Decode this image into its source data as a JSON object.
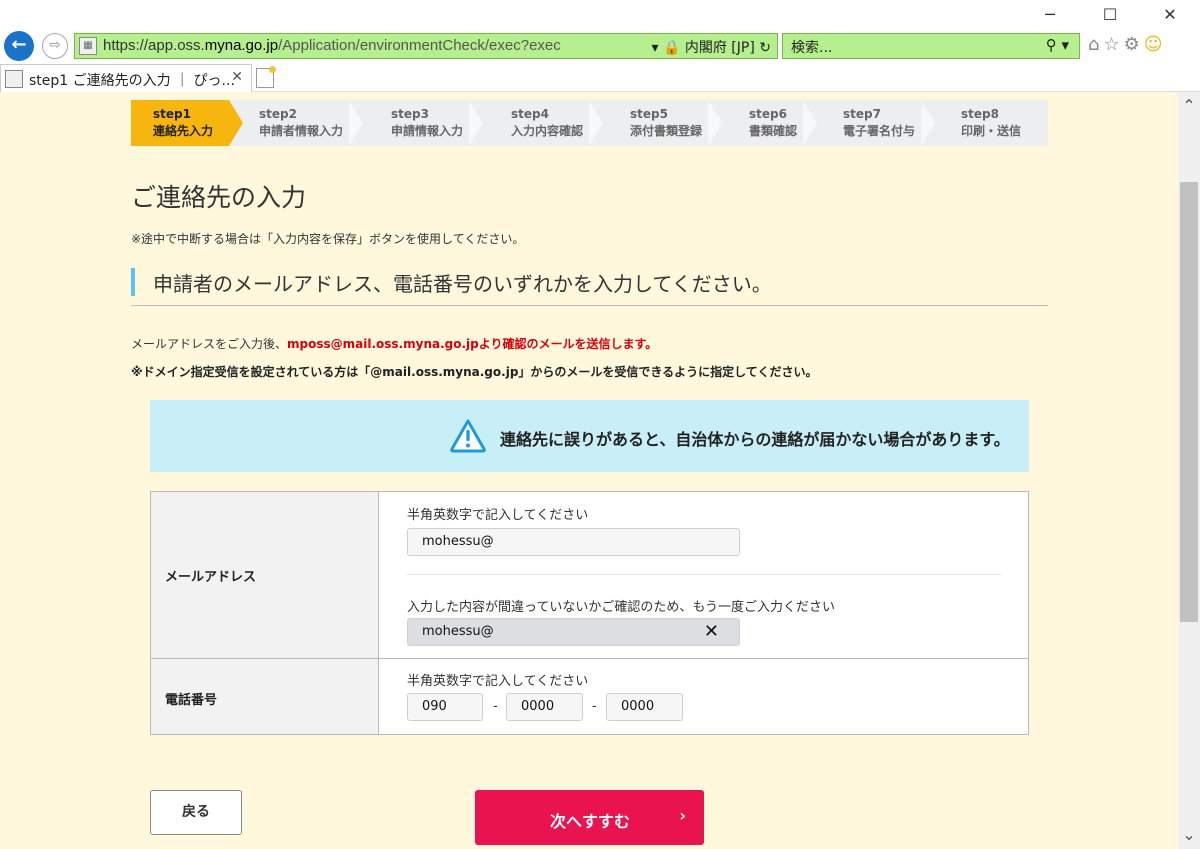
{
  "browser": {
    "url_host_prefix": "https://app.oss.",
    "url_host_domain": "myna.go.jp",
    "url_path": "/Application/environmentCheck/exec?exec",
    "cert_label": "内閣府 [JP]",
    "search_placeholder": "検索...",
    "tab_title": "step1 ご連絡先の入力 ｜ ぴっ...",
    "icons": [
      "back-arrow-icon",
      "forward-arrow-icon",
      "lock-icon",
      "refresh-icon",
      "search-icon",
      "home-icon",
      "star-icon",
      "gear-icon",
      "smiley-icon"
    ]
  },
  "steps": [
    {
      "num": "step1",
      "label": "連絡先入力",
      "active": true
    },
    {
      "num": "step2",
      "label": "申請者情報入力",
      "active": false
    },
    {
      "num": "step3",
      "label": "申請情報入力",
      "active": false
    },
    {
      "num": "step4",
      "label": "入力内容確認",
      "active": false
    },
    {
      "num": "step5",
      "label": "添付書類登録",
      "active": false
    },
    {
      "num": "step6",
      "label": "書類確認",
      "active": false
    },
    {
      "num": "step7",
      "label": "電子署名付与",
      "active": false
    },
    {
      "num": "step8",
      "label": "印刷・送信",
      "active": false
    }
  ],
  "page": {
    "title": "ご連絡先の入力",
    "note": "※途中で中断する場合は「入力内容を保存」ボタンを使用してください。",
    "section_heading": "申請者のメールアドレス、電話番号のいずれかを入力してください。",
    "info_prefix": "メールアドレスをご入力後、",
    "info_highlight": "mposs@mail.oss.myna.go.jpより確認のメールを送信します。",
    "info_domain": "※ドメイン指定受信を設定されている方は「@mail.oss.myna.go.jp」からのメールを受信できるように指定してください。",
    "alert_text": "連絡先に誤りがあると、自治体からの連絡が届かない場合があります。"
  },
  "form": {
    "email_label": "メールアドレス",
    "email_hint": "半角英数字で記入してください",
    "email_value": "mohessu@",
    "email_confirm_hint": "入力した内容が間違っていないかご確認のため、もう一度ご入力ください",
    "email_confirm_value": "mohessu@",
    "clear_symbol": "✕",
    "phone_label": "電話番号",
    "phone_hint": "半角英数字で記入してください",
    "phone_1": "090",
    "phone_2": "0000",
    "phone_3": "0000",
    "dash": "-"
  },
  "buttons": {
    "back": "戻る",
    "next": "次へすすむ",
    "next_arrow": "›"
  },
  "colors": {
    "page_bg": "#fff8dd",
    "step_active": "#f7b60d",
    "alert_bg": "#c8eef8",
    "accent_blue": "#5ec5ea",
    "next_button": "#e8134f",
    "highlight_red": "#d8000c"
  }
}
